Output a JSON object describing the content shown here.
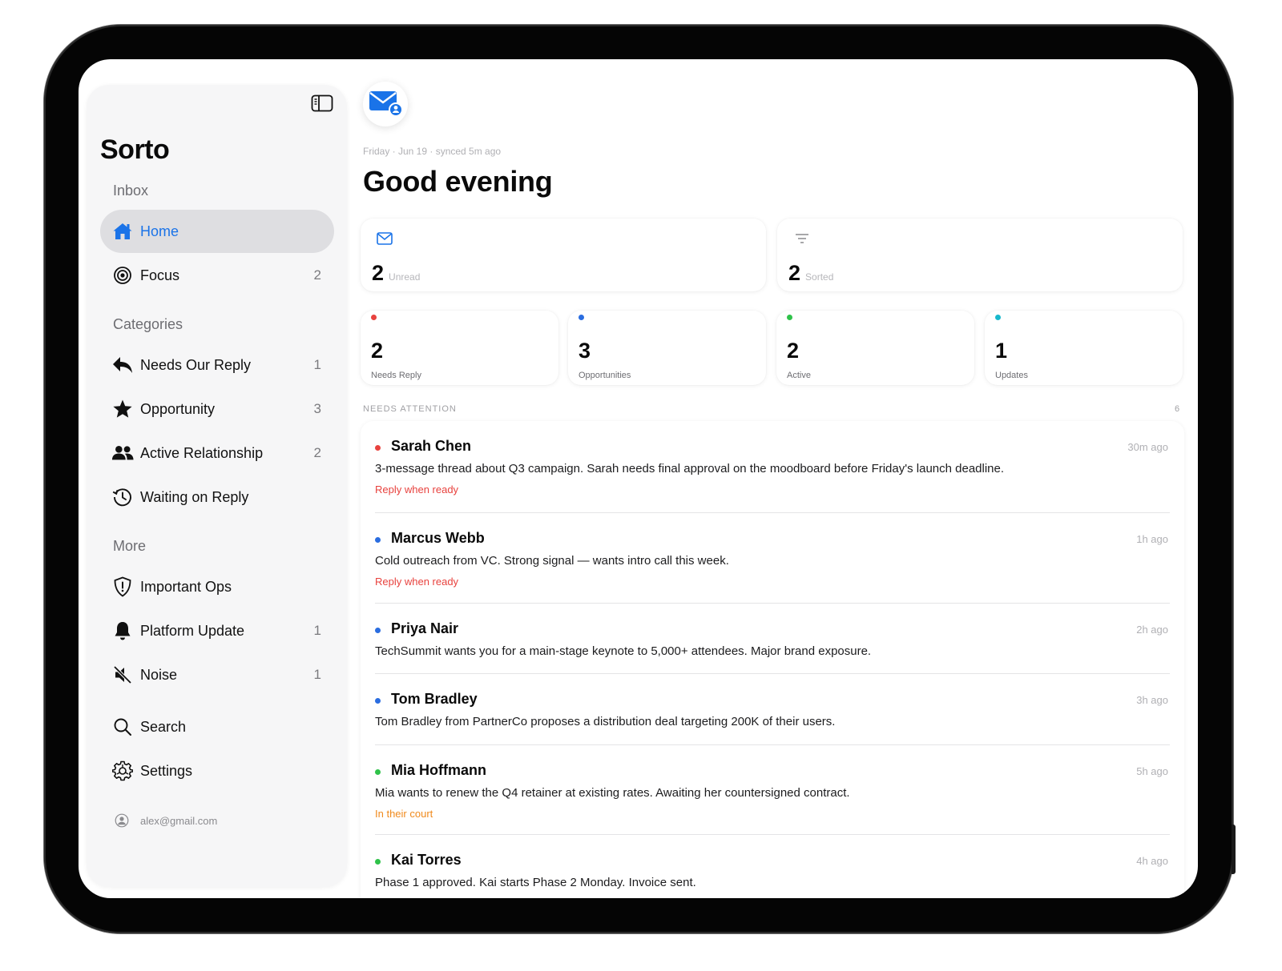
{
  "colors": {
    "accent": "#1a73e8",
    "red": "#e8423e",
    "blue": "#2a6de0",
    "green": "#2fc24a",
    "teal": "#18b8cc",
    "orange": "#f08a1c"
  },
  "sidebar": {
    "title": "Sorto",
    "toggle_icon": "sidebar-toggle-icon",
    "inbox_label": "Inbox",
    "inbox_items": [
      {
        "label": "Home",
        "count": "",
        "icon": "house-icon",
        "active": true
      },
      {
        "label": "Focus",
        "count": "2",
        "icon": "target-icon"
      }
    ],
    "categories_label": "Categories",
    "category_items": [
      {
        "label": "Needs Our Reply",
        "count": "1",
        "icon": "reply-arrow-icon"
      },
      {
        "label": "Opportunity",
        "count": "3",
        "icon": "star-icon"
      },
      {
        "label": "Active Relationship",
        "count": "2",
        "icon": "people-icon"
      },
      {
        "label": "Waiting on Reply",
        "count": "",
        "icon": "history-clock-icon"
      }
    ],
    "more_label": "More",
    "more_items": [
      {
        "label": "Important Ops",
        "count": "",
        "icon": "shield-icon"
      },
      {
        "label": "Platform Update",
        "count": "1",
        "icon": "bell-icon"
      },
      {
        "label": "Noise",
        "count": "1",
        "icon": "speaker-muted-icon"
      }
    ],
    "utility_items": [
      {
        "label": "Search",
        "icon": "search-icon"
      },
      {
        "label": "Settings",
        "icon": "gear-icon"
      }
    ],
    "account_email": "alex@gmail.com"
  },
  "main": {
    "app_icon": "mail-person-icon",
    "date_line": "Friday · Jun 19 · synced 5m ago",
    "greeting": "Good evening",
    "summary_cards": [
      {
        "value": "2",
        "label": "Unread",
        "icon": "envelope-icon"
      },
      {
        "value": "2",
        "label": "Sorted",
        "icon": "filter-lines-icon"
      }
    ],
    "stat_cards": [
      {
        "value": "2",
        "label": "Needs Reply",
        "color": "#e8423e"
      },
      {
        "value": "3",
        "label": "Opportunities",
        "color": "#2a6de0"
      },
      {
        "value": "2",
        "label": "Active",
        "color": "#2fc24a"
      },
      {
        "value": "1",
        "label": "Updates",
        "color": "#18b8cc"
      }
    ],
    "attention_label": "NEEDS ATTENTION",
    "attention_count": "6",
    "messages": [
      {
        "name": "Sarah Chen",
        "time": "30m ago",
        "summary": "3-message thread about Q3 campaign. Sarah needs final approval on the moodboard before Friday's launch deadline.",
        "tag": "Reply when ready",
        "tag_color": "#e8423e",
        "dot": "#e8423e"
      },
      {
        "name": "Marcus Webb",
        "time": "1h ago",
        "summary": "Cold outreach from VC. Strong signal — wants intro call this week.",
        "tag": "Reply when ready",
        "tag_color": "#e8423e",
        "dot": "#2a6de0"
      },
      {
        "name": "Priya Nair",
        "time": "2h ago",
        "summary": "TechSummit wants you for a main-stage keynote to 5,000+ attendees. Major brand exposure.",
        "tag": "",
        "dot": "#2a6de0"
      },
      {
        "name": "Tom Bradley",
        "time": "3h ago",
        "summary": "Tom Bradley from PartnerCo proposes a distribution deal targeting 200K of their users.",
        "tag": "",
        "dot": "#2a6de0"
      },
      {
        "name": "Mia Hoffmann",
        "time": "5h ago",
        "summary": "Mia wants to renew the Q4 retainer at existing rates. Awaiting her countersigned contract.",
        "tag": "In their court",
        "tag_color": "#f08a1c",
        "dot": "#2fc24a"
      },
      {
        "name": "Kai Torres",
        "time": "4h ago",
        "summary": "Phase 1 approved. Kai starts Phase 2 Monday. Invoice sent.",
        "tag": "",
        "dot": "#2fc24a"
      }
    ]
  }
}
